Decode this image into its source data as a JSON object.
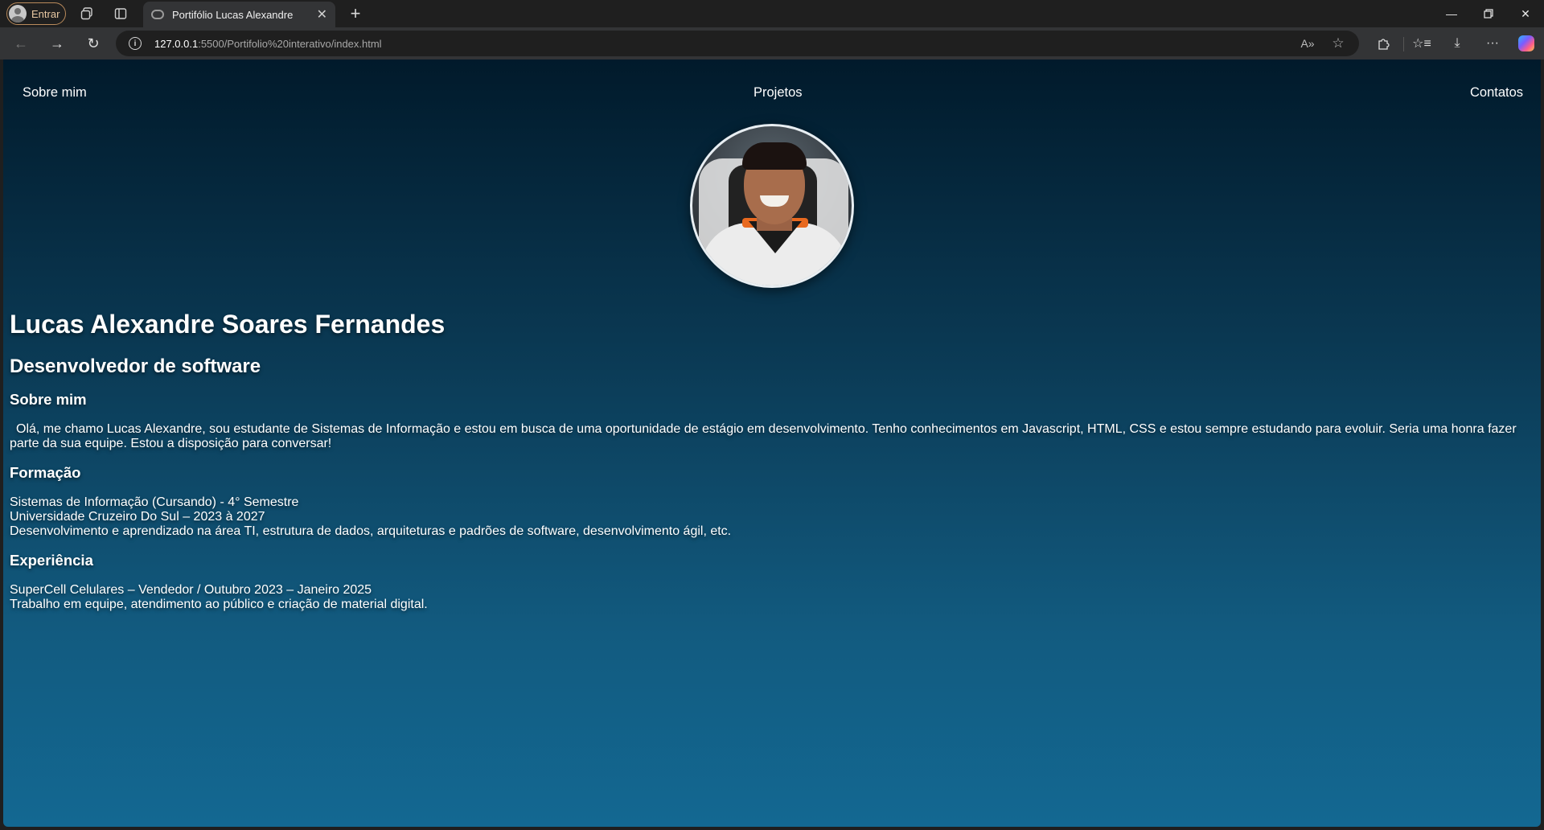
{
  "browser": {
    "profile_label": "Entrar",
    "tab_title": "Portifólio Lucas Alexandre",
    "url_host": "127.0.0.1",
    "url_path": ":5500/Portifolio%20interativo/index.html"
  },
  "page": {
    "nav": {
      "about": "Sobre mim",
      "projects": "Projetos",
      "contacts": "Contatos"
    },
    "name": "Lucas Alexandre Soares Fernandes",
    "role": "Desenvolvedor de software",
    "about": {
      "heading": "Sobre mim",
      "text": "Olá, me chamo Lucas Alexandre, sou estudante de Sistemas de Informação e estou em busca de uma oportunidade de estágio em desenvolvimento. Tenho conhecimentos em Javascript, HTML, CSS e estou sempre estudando para evoluir. Seria uma honra fazer parte da sua equipe. Estou a disposição para conversar!"
    },
    "education": {
      "heading": "Formação",
      "line1": "Sistemas de Informação (Cursando) - 4° Semestre",
      "line2": "Universidade Cruzeiro Do Sul – 2023 à 2027",
      "line3": "Desenvolvimento e aprendizado na área TI, estrutura de dados, arquiteturas e padrões de software, desenvolvimento ágil, etc."
    },
    "experience": {
      "heading": "Experiência",
      "line1": "SuperCell Celulares – Vendedor / Outubro 2023 – Janeiro 2025",
      "line2": "Trabalho em equipe, atendimento ao público e criação de material digital."
    }
  },
  "icons": {
    "workspaces": "workspaces-icon",
    "vertical_tabs": "vertical-tabs-icon",
    "back": "back-arrow-icon",
    "forward": "forward-arrow-icon",
    "refresh": "refresh-icon",
    "read_aloud": "read-aloud-icon",
    "favorite": "star-icon",
    "extensions": "puzzle-icon",
    "favorites": "favorites-icon",
    "downloads": "download-icon",
    "more": "more-icon",
    "copilot": "copilot-icon"
  },
  "colors": {
    "page_gradient_top": "#011a2b",
    "page_gradient_bottom": "#136892",
    "chrome_bg": "#1f1f1f",
    "toolbar_bg": "#333436"
  }
}
